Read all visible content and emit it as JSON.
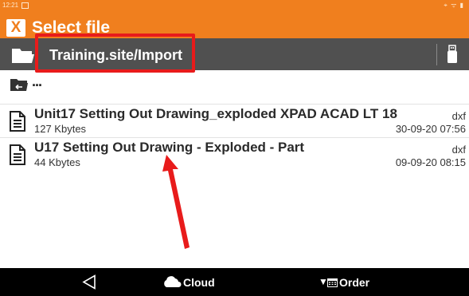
{
  "status_bar": {
    "time": "12:21"
  },
  "header": {
    "title": "Select file",
    "logo_text": "X"
  },
  "path_bar": {
    "path": "Training.site/Import"
  },
  "parent": {
    "label": "..."
  },
  "files": [
    {
      "name": "Unit17 Setting Out Drawing_exploded XPAD ACAD LT 18",
      "size": "127 Kbytes",
      "ext": "dxf",
      "date": "30-09-20 07:56"
    },
    {
      "name": "U17 Setting Out Drawing - Exploded - Part",
      "size": "44 Kbytes",
      "ext": "dxf",
      "date": "09-09-20 08:15"
    }
  ],
  "bottom_bar": {
    "cloud_label": "Cloud",
    "order_label": "Order"
  },
  "icons": {
    "app_logo": "xpad-logo-icon",
    "folder": "folder-open-icon",
    "usb": "usb-icon",
    "parent": "folder-up-icon",
    "file": "document-icon",
    "back": "back-triangle-icon",
    "cloud": "cloud-icon",
    "order": "calendar-sort-icon"
  },
  "colors": {
    "header": "#f07f1e",
    "path_bar": "#505050",
    "highlight": "#e81b1b",
    "bottom_bar": "#000000"
  }
}
